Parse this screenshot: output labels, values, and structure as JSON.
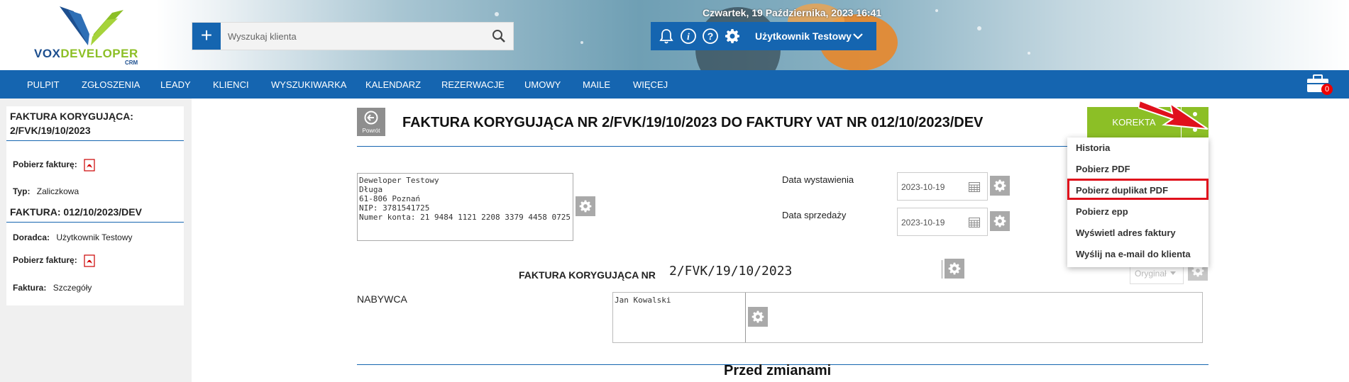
{
  "header": {
    "logo": {
      "brand_left": "VOX",
      "brand_right": "DEVELOPER",
      "brand_sub": "CRM"
    },
    "search": {
      "placeholder": "Wyszukaj klienta",
      "value": ""
    },
    "datetime": "Czwartek, 19 Października, 2023   16:41",
    "user": {
      "name": "Użytkownik Testowy"
    },
    "icons": [
      "plus-icon",
      "search-icon",
      "bell-icon",
      "info-icon",
      "help-icon",
      "gear-icon",
      "chevron-down-icon"
    ]
  },
  "nav": {
    "items": [
      "PULPIT",
      "ZGŁOSZENIA",
      "LEADY",
      "KLIENCI",
      "WYSZUKIWARKA",
      "KALENDARZ",
      "REZERWACJE",
      "UMOWY",
      "MAILE",
      "WIĘCEJ"
    ],
    "cart_badge": "0"
  },
  "sidebar": {
    "correction": {
      "title": "FAKTURA KORYGUJĄCA: 2/FVK/19/10/2023",
      "download_label": "Pobierz fakturę:",
      "type_label": "Typ:",
      "type_value": "Zaliczkowa"
    },
    "invoice": {
      "title": "FAKTURA: 012/10/2023/DEV",
      "advisor_label": "Doradca:",
      "advisor_value": "Użytkownik Testowy",
      "download_label": "Pobierz fakturę:",
      "invoice_label": "Faktura:",
      "invoice_value": "Szczegóły"
    }
  },
  "main": {
    "back_label": "Powrót",
    "title": "FAKTURA KORYGUJĄCA NR 2/FVK/19/10/2023 DO FAKTURY VAT NR 012/10/2023/DEV",
    "korekta_label": "KOREKTA",
    "seller": {
      "line1": "Deweloper Testowy",
      "line2": "Długa",
      "line3": "61-806 Poznań",
      "line4": "NIP: 3781541725",
      "line5": "Numer konta: 21 9484 1121 2208 3379 4458 0725"
    },
    "issue_date_label": "Data wystawienia",
    "issue_date": "2023-10-19",
    "sale_date_label": "Data sprzedaży",
    "sale_date": "2023-10-19",
    "correction_no_label": "FAKTURA KORYGUJĄCA NR",
    "correction_no": "2/FVK/19/10/2023",
    "copy_select": "Oryginał",
    "buyer_label": "NABYWCA",
    "buyer_name": "Jan Kowalski",
    "before_changes": "Przed zmianami"
  },
  "menu": {
    "items": [
      "Historia",
      "Pobierz PDF",
      "Pobierz duplikat PDF",
      "Pobierz epp",
      "Wyświetl adres faktury",
      "Wyślij na e-mail do klienta"
    ],
    "highlighted": "Pobierz duplikat PDF"
  },
  "colors": {
    "primary": "#1565b0",
    "accent_green": "#8cbf26",
    "highlight_red": "#e0101c",
    "gear_gray": "#a9a9a9"
  }
}
